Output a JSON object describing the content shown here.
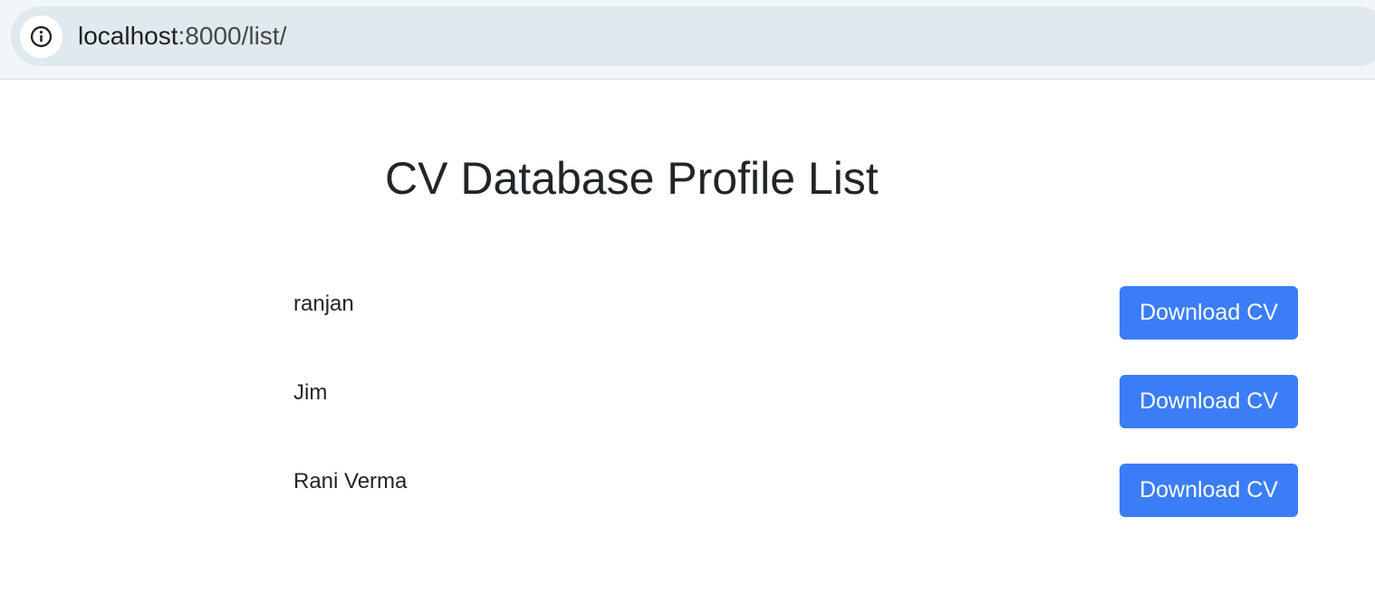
{
  "browser": {
    "url_host": "localhost",
    "url_rest": ":8000/list/",
    "info_icon": "info-icon"
  },
  "page": {
    "title": "CV Database Profile List"
  },
  "profiles": [
    {
      "name": "ranjan",
      "button_label": "Download CV"
    },
    {
      "name": "Jim",
      "button_label": "Download CV"
    },
    {
      "name": "Rani Verma",
      "button_label": "Download CV"
    }
  ],
  "colors": {
    "button_bg": "#3b7df6",
    "text": "#212529",
    "address_bar": "#dfe9ee"
  }
}
